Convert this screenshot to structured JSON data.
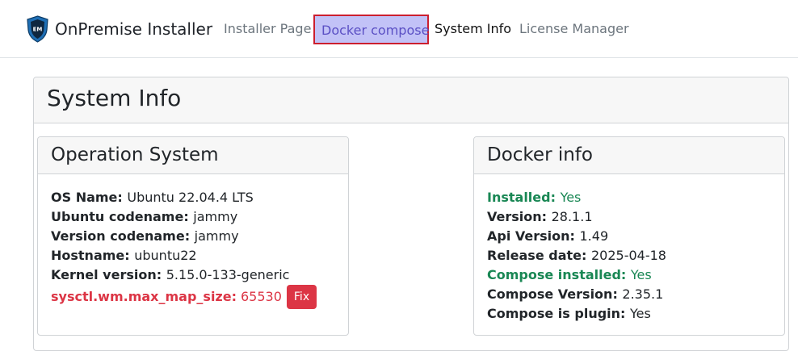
{
  "app": {
    "title": "OnPremise Installer",
    "logo_text": "EM"
  },
  "nav": {
    "items": [
      {
        "label": "Installer Page"
      },
      {
        "label": "Docker compose"
      },
      {
        "label": "System Info"
      },
      {
        "label": "License Manager"
      }
    ]
  },
  "page": {
    "title": "System Info"
  },
  "os_card": {
    "title": "Operation System",
    "rows": [
      {
        "key": "OS Name:",
        "value": "Ubuntu 22.04.4 LTS"
      },
      {
        "key": "Ubuntu codename:",
        "value": "jammy"
      },
      {
        "key": "Version codename:",
        "value": "jammy"
      },
      {
        "key": "Hostname:",
        "value": "ubuntu22"
      },
      {
        "key": "Kernel version:",
        "value": "5.15.0-133-generic"
      }
    ],
    "warning": {
      "key": "sysctl.wm.max_map_size:",
      "value": "65530",
      "button": "Fix"
    }
  },
  "docker_card": {
    "title": "Docker info",
    "rows": [
      {
        "key": "Installed:",
        "value": "Yes",
        "status": "ok"
      },
      {
        "key": "Version:",
        "value": "28.1.1"
      },
      {
        "key": "Api Version:",
        "value": "1.49"
      },
      {
        "key": "Release date:",
        "value": "2025-04-18"
      },
      {
        "key": "Compose installed:",
        "value": "Yes",
        "status": "ok"
      },
      {
        "key": "Compose Version:",
        "value": "2.35.1"
      },
      {
        "key": "Compose is plugin:",
        "value": "Yes"
      }
    ]
  },
  "colors": {
    "accent": "#c2c2f7",
    "highlight_border": "#cc1f2f",
    "success": "#198754",
    "danger": "#dc3545",
    "logo_shield": "#1f6fb5"
  }
}
